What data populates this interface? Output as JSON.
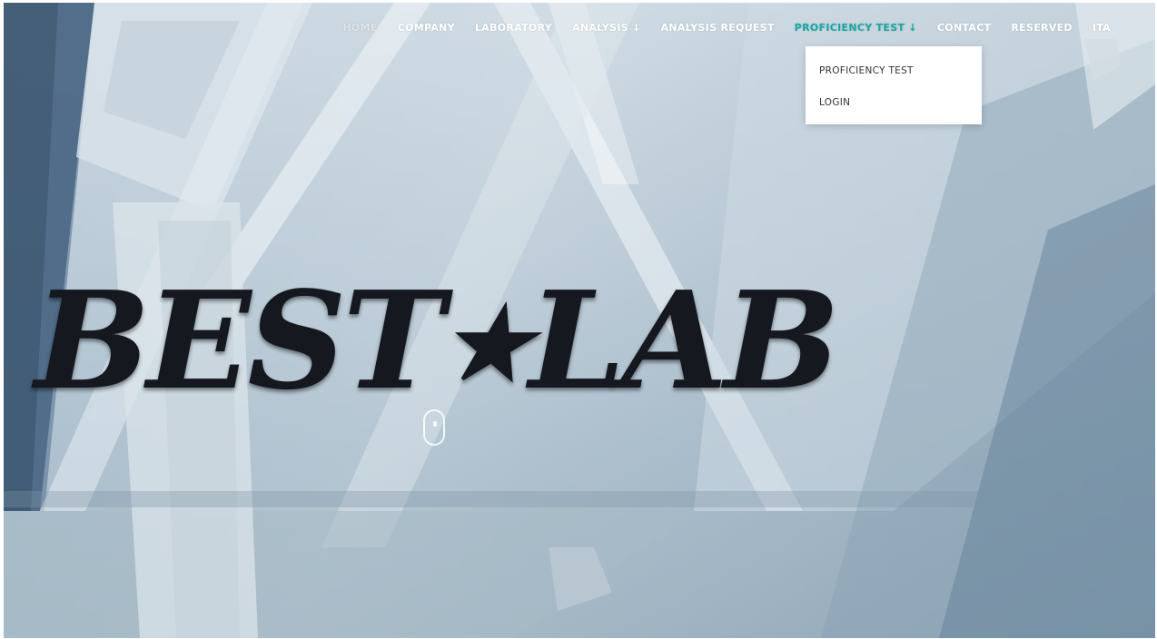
{
  "nav": {
    "items": [
      {
        "label": "HOME",
        "state": "dimmed"
      },
      {
        "label": "COMPANY"
      },
      {
        "label": "LABORATORY"
      },
      {
        "label": "ANALYSIS ↓"
      },
      {
        "label": "ANALYSIS REQUEST"
      },
      {
        "label": "PROFICIENCY TEST ↓",
        "state": "active"
      },
      {
        "label": "CONTACT"
      },
      {
        "label": "RESERVED"
      },
      {
        "label": "ITA"
      }
    ]
  },
  "dropdown": {
    "items": [
      {
        "label": "PROFICIENCY TEST"
      },
      {
        "label": "LOGIN"
      }
    ]
  },
  "hero": {
    "logo_text_left": "BEST",
    "logo_star": "★",
    "logo_text_right": "LAB"
  },
  "colors": {
    "accent": "#16a7a5",
    "logo": "#15181f",
    "nav_text": "#ffffff"
  },
  "icons": {
    "scroll_indicator": "mouse-scroll-icon"
  }
}
